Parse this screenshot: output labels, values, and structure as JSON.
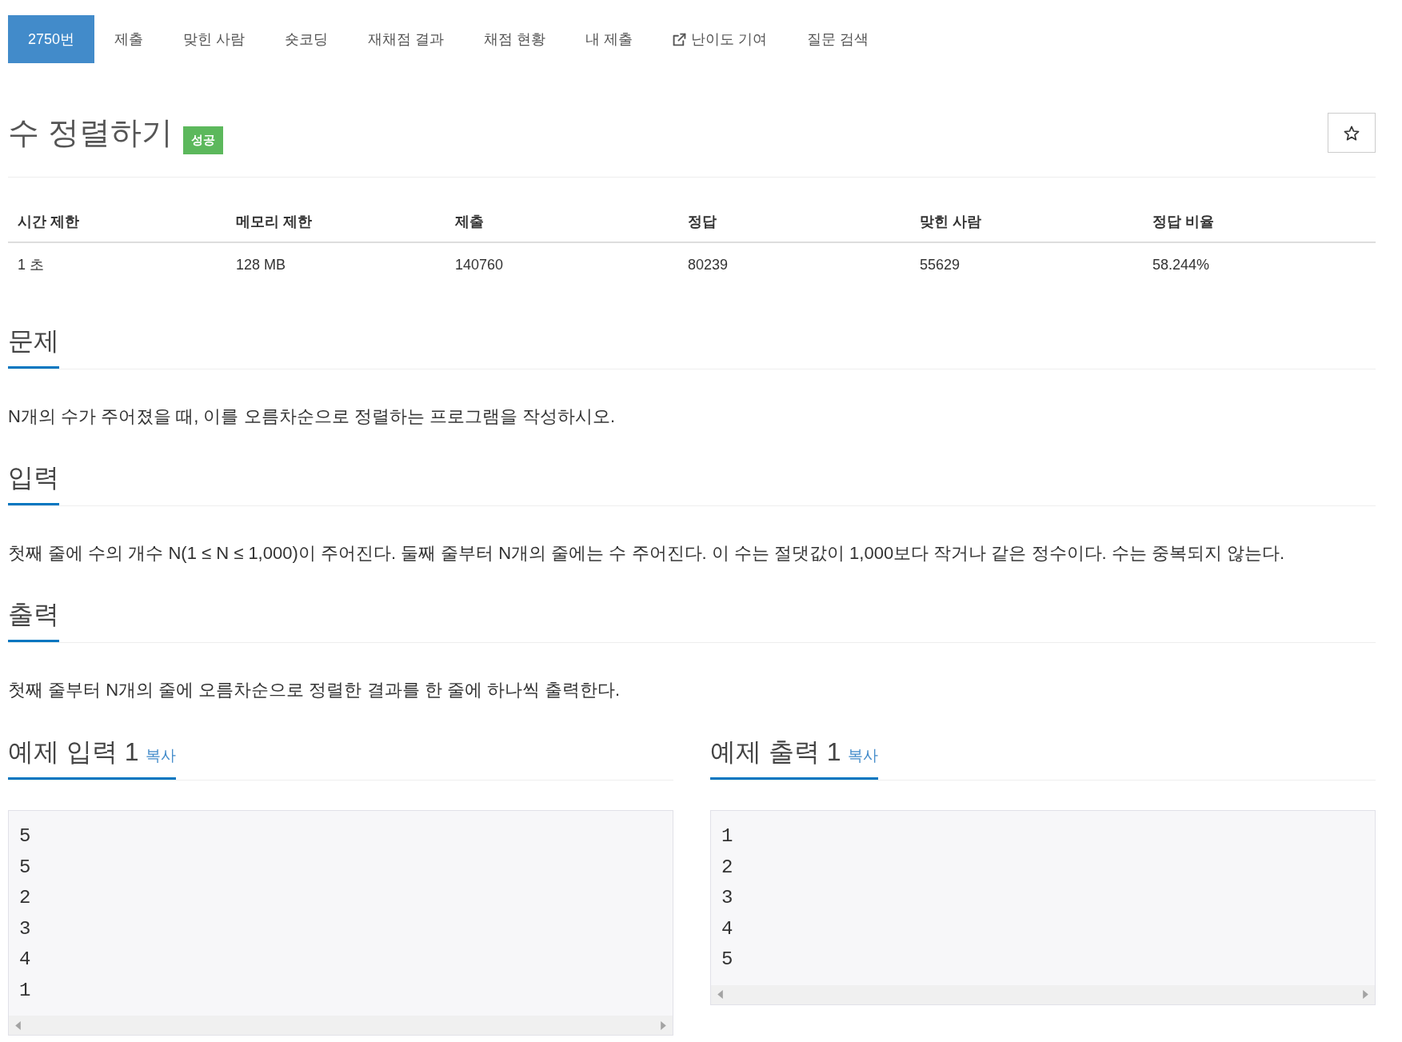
{
  "tabs": [
    {
      "label": "2750번",
      "selected": true,
      "external": false
    },
    {
      "label": "제출",
      "selected": false,
      "external": false
    },
    {
      "label": "맞힌 사람",
      "selected": false,
      "external": false
    },
    {
      "label": "숏코딩",
      "selected": false,
      "external": false
    },
    {
      "label": "재채점 결과",
      "selected": false,
      "external": false
    },
    {
      "label": "채점 현황",
      "selected": false,
      "external": false
    },
    {
      "label": "내 제출",
      "selected": false,
      "external": false
    },
    {
      "label": "난이도 기여",
      "selected": false,
      "external": true
    },
    {
      "label": "질문 검색",
      "selected": false,
      "external": false
    }
  ],
  "problem": {
    "title": "수 정렬하기",
    "badge": {
      "label": "성공",
      "kind": "success"
    },
    "starred": false
  },
  "limits_table": {
    "columns": [
      "시간 제한",
      "메모리 제한",
      "제출",
      "정답",
      "맞힌 사람",
      "정답 비율"
    ],
    "rows": [
      [
        "1 초",
        "128 MB",
        "140760",
        "80239",
        "55629",
        "58.244%"
      ]
    ]
  },
  "sections": [
    {
      "heading": "문제",
      "text": "N개의 수가 주어졌을 때, 이를 오름차순으로 정렬하는 프로그램을 작성하시오."
    },
    {
      "heading": "입력",
      "text": "첫째 줄에 수의 개수 N(1 ≤ N ≤ 1,000)이 주어진다. 둘째 줄부터 N개의 줄에는 수 주어진다. 이 수는 절댓값이 1,000보다 작거나 같은 정수이다. 수는 중복되지 않는다."
    },
    {
      "heading": "출력",
      "text": "첫째 줄부터 N개의 줄에 오름차순으로 정렬한 결과를 한 줄에 하나씩 출력한다."
    }
  ],
  "samples": [
    {
      "heading": "예제 입력 1",
      "copy_label": "복사",
      "lines": [
        "5",
        "5",
        "2",
        "3",
        "4",
        "1"
      ]
    },
    {
      "heading": "예제 출력 1",
      "copy_label": "복사",
      "lines": [
        "1",
        "2",
        "3",
        "4",
        "5"
      ]
    }
  ]
}
